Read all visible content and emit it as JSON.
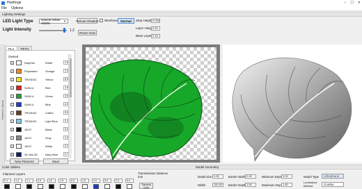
{
  "window": {
    "title": "Hueforge",
    "controls": [
      "–",
      "☐",
      "✕"
    ]
  },
  "menu": [
    "File",
    "Options"
  ],
  "lighting": {
    "header": "Lighting Settings",
    "led_label": "LED Light Type",
    "led_value": "Natural White 4000K",
    "intensity_label": "Light Intensity",
    "intensity_value": "1.2",
    "reload_button": "Reload Shaders",
    "wireframe_label": "Wireframe",
    "normal_button": "Normal",
    "reset_button": "Reset View",
    "step_height_label": "Step Height",
    "step_height_value": "0.040",
    "layer_height_label": "Layer Height",
    "layer_height_value": "0.20",
    "base_layer_label": "Base Layer",
    "base_layer_value": "0.16"
  },
  "tabs": [
    "PLA",
    "PETG"
  ],
  "side_strip": "Filament Library",
  "filaments": {
    "owned_label": "Owned",
    "rows": [
      {
        "brand": "NinjaTek",
        "color": "White",
        "td": "1.8",
        "hex": "#ffffff"
      },
      {
        "brand": "Polymaker",
        "color": "Orange",
        "td": "1.5",
        "hex": "#f08a1c"
      },
      {
        "brand": "TRONXIC",
        "color": "Yellow",
        "td": "6.5",
        "hex": "#f2e21a"
      },
      {
        "brand": "SUNLU",
        "color": "Red",
        "td": "1.5",
        "hex": "#e0201f"
      },
      {
        "brand": "SUNLU",
        "color": "Green",
        "td": "4.6",
        "hex": "#20a03a"
      },
      {
        "brand": "SUNLU",
        "color": "Blue",
        "td": "4.0",
        "hex": "#1b3dc6"
      },
      {
        "brand": "TRONXIC",
        "color": "Coffee",
        "td": "0.5",
        "hex": "#6b3d1e"
      },
      {
        "brand": "TRONXIC",
        "color": "Light Blue",
        "td": "4.4",
        "hex": "#7fc8ef"
      },
      {
        "brand": "JAYO",
        "color": "Black",
        "td": "0.6",
        "hex": "#111111"
      },
      {
        "brand": "JAYO",
        "color": "Gray",
        "td": "1.6",
        "hex": "#8a8a8a"
      },
      {
        "brand": "JAYO",
        "color": "White",
        "td": "3.0",
        "hex": "#f6f6f6"
      },
      {
        "brand": "3D Mia 3D",
        "color": "Navy Blue",
        "td": "0.7",
        "hex": "#0f1d5a"
      }
    ],
    "new_button": "New Filament",
    "save_button": "Save"
  },
  "color_sliders": {
    "header": "Color Sliders",
    "filament_layers_label": "Filament Layers",
    "values": [
      "0.1",
      "1.3",
      "1.1",
      "0.5",
      "4.0",
      "1.5",
      "0.5",
      "1.5",
      "4.0",
      "5.0",
      "2.0",
      "5.0"
    ],
    "swatches": [
      "#111111",
      "#ffffff",
      "#111111",
      "#f6f6f6",
      "#111111",
      "#ffffff",
      "#111111",
      "#f6f6f6",
      "#1b3dc6",
      "#f6f6f6",
      "#111111",
      "#ffffff"
    ]
  },
  "transmission": {
    "label": "Transmission Distance mm",
    "button": "Transmit Color"
  },
  "model_geometry": {
    "header": "Model Geometry",
    "detail_size_label": "Detail Size",
    "detail_size_value": "0.30",
    "border_width_label": "Border Width",
    "border_width_value": "2.00",
    "min_depth_label": "Minimum Depth",
    "min_depth_value": "0.00",
    "model_type_label": "Model Type",
    "model_type_value": "Lithophane",
    "width_label": "Width",
    "width_value": "150.00",
    "border_depth_label": "Border Depth",
    "border_depth_value": "1.50",
    "max_depth_label": "Maximum Depth",
    "max_depth_value": "1.60",
    "luminance_label": "Luminance Method",
    "luminance_value": "Combo"
  }
}
